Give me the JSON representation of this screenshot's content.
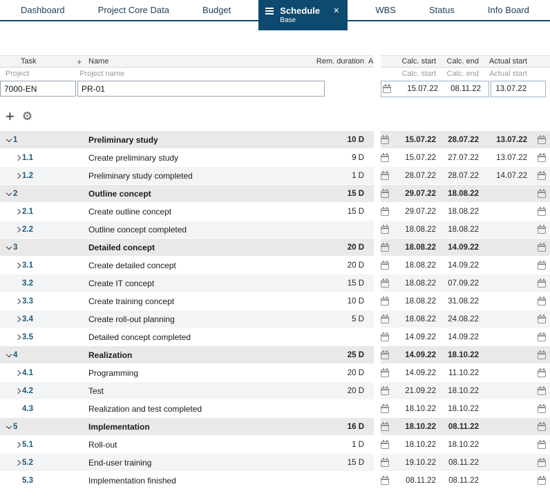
{
  "nav": {
    "tabs": [
      {
        "label": "Dashboard",
        "active": false
      },
      {
        "label": "Project Core Data",
        "active": false
      },
      {
        "label": "Budget",
        "active": false
      },
      {
        "label": "Schedule",
        "active": true,
        "sublabel": "Base"
      },
      {
        "label": "WBS",
        "active": false
      },
      {
        "label": "Status",
        "active": false
      },
      {
        "label": "Info Board",
        "active": false
      }
    ]
  },
  "icons": {
    "menu": "hamburger",
    "close": "✕",
    "add": "+",
    "settings": "⚙",
    "calendar": "calendar-outline",
    "chevron_down": "v",
    "chevron_right": ">"
  },
  "colors": {
    "accent_dark_blue": "#0e4a70",
    "task_number_blue": "#19587f",
    "group_row_bg": "#e9e9e9",
    "alt_row_bg": "#f3f4f5"
  },
  "table": {
    "header": {
      "task": "Task",
      "plus": "+",
      "name": "Name",
      "rem_duration": "Rem. duration",
      "a_col": "A",
      "calc_start": "Calc. start",
      "calc_end": "Calc. end",
      "actual_start": "Actual start"
    },
    "subheader": {
      "project": "Project",
      "project_name": "Project name",
      "calc_start": "Calc. start",
      "calc_end": "Calc. end",
      "actual_start": "Actual start"
    },
    "project_row": {
      "task_id": "7000-EN",
      "name": "PR-01",
      "calc_start": "15.07.22",
      "calc_end": "08.11.22",
      "actual_start": "13.07.22"
    }
  },
  "rows": [
    {
      "num": "1",
      "name": "Preliminary study",
      "dur": "10 D",
      "calc_start": "15.07.22",
      "calc_end": "28.07.22",
      "actual_start": "13.07.22",
      "group": true,
      "chevron": "down"
    },
    {
      "num": "1.1",
      "name": "Create preliminary study",
      "dur": "9 D",
      "calc_start": "15.07.22",
      "calc_end": "27.07.22",
      "actual_start": "13.07.22",
      "group": false,
      "chevron": "right"
    },
    {
      "num": "1.2",
      "name": "Preliminary study completed",
      "dur": "1 D",
      "calc_start": "28.07.22",
      "calc_end": "28.07.22",
      "actual_start": "14.07.22",
      "group": false,
      "chevron": "right"
    },
    {
      "num": "2",
      "name": "Outline concept",
      "dur": "15 D",
      "calc_start": "29.07.22",
      "calc_end": "18.08.22",
      "actual_start": "",
      "group": true,
      "chevron": "down"
    },
    {
      "num": "2.1",
      "name": "Create outline concept",
      "dur": "15 D",
      "calc_start": "29.07.22",
      "calc_end": "18.08.22",
      "actual_start": "",
      "group": false,
      "chevron": "right"
    },
    {
      "num": "2.2",
      "name": "Outline concept completed",
      "dur": "",
      "calc_start": "18.08.22",
      "calc_end": "18.08.22",
      "actual_start": "",
      "group": false,
      "chevron": "right"
    },
    {
      "num": "3",
      "name": "Detailed concept",
      "dur": "20 D",
      "calc_start": "18.08.22",
      "calc_end": "14.09.22",
      "actual_start": "",
      "group": true,
      "chevron": "down"
    },
    {
      "num": "3.1",
      "name": "Create detailed concept",
      "dur": "20 D",
      "calc_start": "18.08.22",
      "calc_end": "14.09.22",
      "actual_start": "",
      "group": false,
      "chevron": "right"
    },
    {
      "num": "3.2",
      "name": "Create IT concept",
      "dur": "15 D",
      "calc_start": "18.08.22",
      "calc_end": "07.09.22",
      "actual_start": "",
      "group": false,
      "chevron": "none"
    },
    {
      "num": "3.3",
      "name": "Create training concept",
      "dur": "10 D",
      "calc_start": "18.08.22",
      "calc_end": "31.08.22",
      "actual_start": "",
      "group": false,
      "chevron": "right"
    },
    {
      "num": "3.4",
      "name": "Create roll-out planning",
      "dur": "5 D",
      "calc_start": "18.08.22",
      "calc_end": "24.08.22",
      "actual_start": "",
      "group": false,
      "chevron": "right"
    },
    {
      "num": "3.5",
      "name": "Detailed concept completed",
      "dur": "",
      "calc_start": "14.09.22",
      "calc_end": "14.09.22",
      "actual_start": "",
      "group": false,
      "chevron": "right"
    },
    {
      "num": "4",
      "name": "Realization",
      "dur": "25 D",
      "calc_start": "14.09.22",
      "calc_end": "18.10.22",
      "actual_start": "",
      "group": true,
      "chevron": "down"
    },
    {
      "num": "4.1",
      "name": "Programming",
      "dur": "20 D",
      "calc_start": "14.09.22",
      "calc_end": "11.10.22",
      "actual_start": "",
      "group": false,
      "chevron": "right"
    },
    {
      "num": "4.2",
      "name": "Test",
      "dur": "20 D",
      "calc_start": "21.09.22",
      "calc_end": "18.10.22",
      "actual_start": "",
      "group": false,
      "chevron": "right"
    },
    {
      "num": "4.3",
      "name": "Realization and test completed",
      "dur": "",
      "calc_start": "18.10.22",
      "calc_end": "18.10.22",
      "actual_start": "",
      "group": false,
      "chevron": "none"
    },
    {
      "num": "5",
      "name": "Implementation",
      "dur": "16 D",
      "calc_start": "18.10.22",
      "calc_end": "08.11.22",
      "actual_start": "",
      "group": true,
      "chevron": "down"
    },
    {
      "num": "5.1",
      "name": "Roll-out",
      "dur": "1 D",
      "calc_start": "18.10.22",
      "calc_end": "18.10.22",
      "actual_start": "",
      "group": false,
      "chevron": "right"
    },
    {
      "num": "5.2",
      "name": "End-user training",
      "dur": "15 D",
      "calc_start": "19.10.22",
      "calc_end": "08.11.22",
      "actual_start": "",
      "group": false,
      "chevron": "right"
    },
    {
      "num": "5.3",
      "name": "Implementation finished",
      "dur": "",
      "calc_start": "08.11.22",
      "calc_end": "08.11.22",
      "actual_start": "",
      "group": false,
      "chevron": "none"
    }
  ]
}
